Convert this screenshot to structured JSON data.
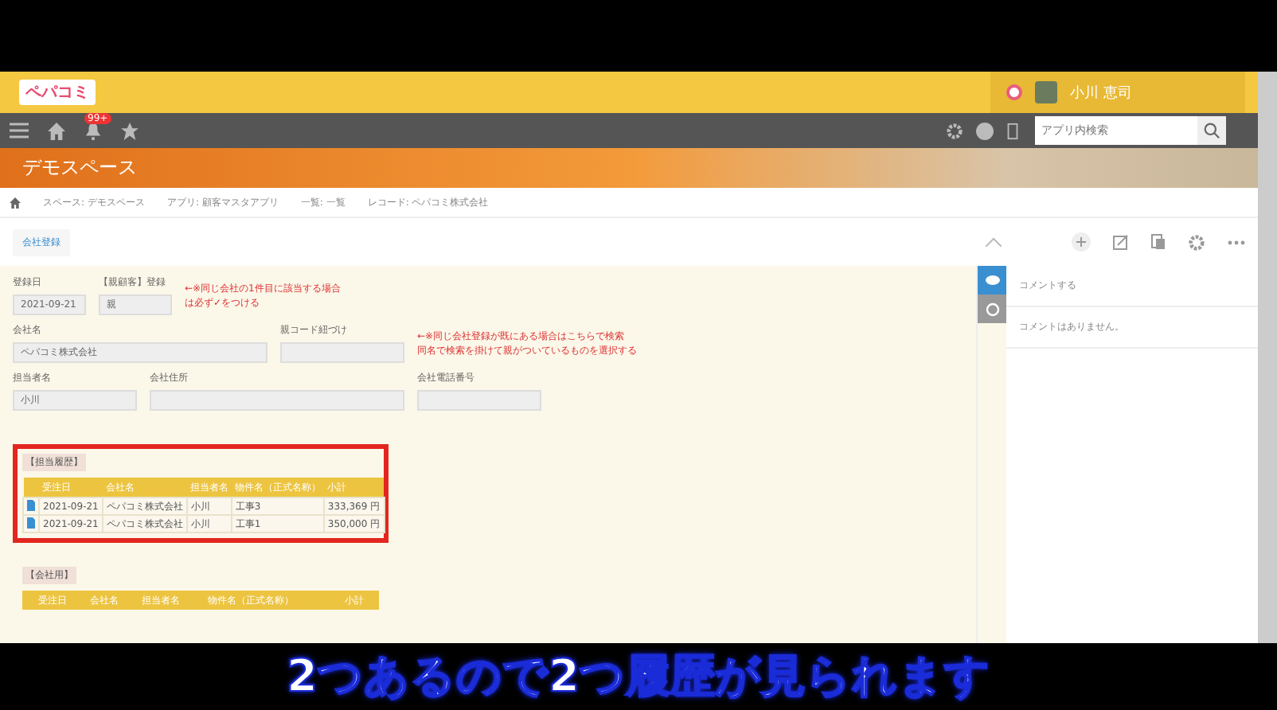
{
  "header": {
    "logo": "ペパコミ",
    "user_name": "小川 恵司"
  },
  "navbar": {
    "notification_badge": "99+",
    "search": {
      "placeholder": "アプリ内検索"
    }
  },
  "banner": {
    "title": "デモスペース"
  },
  "breadcrumbs": [
    "スペース: デモスペース",
    "アプリ: 顧客マスタアプリ",
    "一覧: 一覧",
    "レコード: ペパコミ株式会社"
  ],
  "toolbar": {
    "view_button": "会社登録"
  },
  "form_rows": [
    {
      "fields": [
        {
          "label": "登録日",
          "value": "2021-09-21"
        },
        {
          "label": "【親顧客】登録",
          "value": "親"
        }
      ],
      "note": [
        "←※同じ会社の1件目に該当する場合",
        "は必ず✓をつける"
      ]
    },
    {
      "fields": [
        {
          "label": "会社名",
          "value": "ペパコミ株式会社"
        },
        {
          "label": "親コード紐づけ"
        }
      ],
      "note": [
        "←※同じ会社登録が既にある場合はこちらで検索",
        "同名で検索を掛けて親がついているものを選択する"
      ]
    },
    {
      "fields": [
        {
          "label": "担当者名",
          "value": "小川"
        },
        {
          "label": "会社住所"
        },
        {
          "label": "会社電話番号"
        }
      ]
    }
  ],
  "tables": [
    {
      "title": "【担当履歴】",
      "highlighted": true,
      "columns": [
        "受注日",
        "会社名",
        "担当者名",
        "物件名（正式名称）",
        "小計"
      ],
      "rows": [
        [
          "2021-09-21",
          "ペパコミ株式会社",
          "小川",
          "工事3",
          "333,369 円"
        ],
        [
          "2021-09-21",
          "ペパコミ株式会社",
          "小川",
          "工事1",
          "350,000 円"
        ]
      ]
    },
    {
      "title": "【会社用】",
      "highlighted": false,
      "columns": [
        "受注日",
        "会社名",
        "担当者名",
        "物件名（正式名称）",
        "小計"
      ]
    }
  ],
  "comments": {
    "prompt": "コメントする",
    "empty_message": "コメントはありません。"
  },
  "caption": "2つあるので2つ履歴が見られます"
}
